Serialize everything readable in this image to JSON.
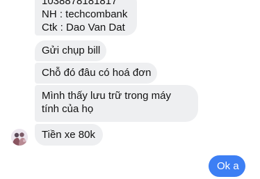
{
  "conversation": {
    "incoming": [
      {
        "lines": [
          "1038878181817",
          "NH : techcombank",
          "Ctk : Dao Van Dat"
        ]
      },
      {
        "text": "Gửi chụp bill"
      },
      {
        "text": "Chỗ đó đâu có hoá đơn"
      },
      {
        "text": "Mình thấy lưu trữ trong máy tính của họ"
      },
      {
        "text": "Tiền xe 80k"
      }
    ],
    "outgoing": [
      {
        "text": "Ok a"
      }
    ],
    "sender": {
      "avatar_icon": "user-avatar"
    }
  },
  "colors": {
    "incoming_bubble": "#eeeff1",
    "outgoing_bubble": "#3d7ff4",
    "outgoing_text": "#ffffff",
    "background": "#ffffff"
  }
}
